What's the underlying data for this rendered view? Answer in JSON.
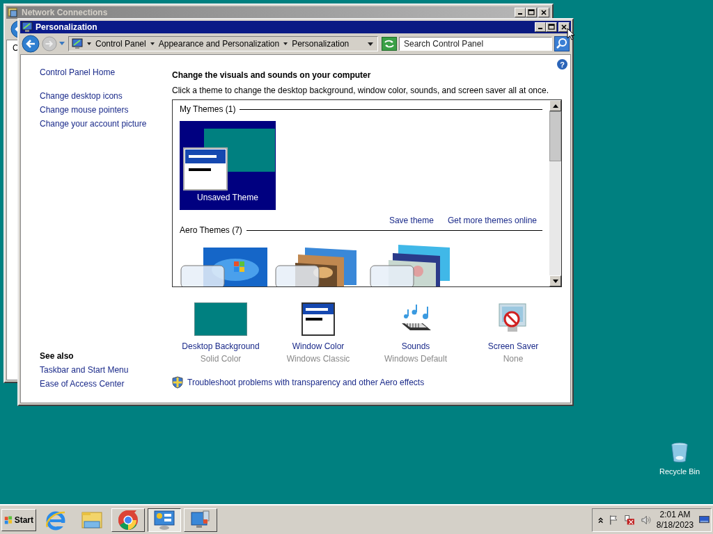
{
  "back_window": {
    "title": "Network Connections",
    "cut_text": "C"
  },
  "window": {
    "title": "Personalization",
    "breadcrumb": [
      "Control Panel",
      "Appearance and Personalization",
      "Personalization"
    ],
    "search": {
      "placeholder": "Search Control Panel"
    },
    "help": "?"
  },
  "sidebar": {
    "links": [
      "Control Panel Home",
      "Change desktop icons",
      "Change mouse pointers",
      "Change your account picture"
    ],
    "see_also_title": "See also",
    "see_also": [
      "Taskbar and Start Menu",
      "Ease of Access Center"
    ]
  },
  "heading": "Change the visuals and sounds on your computer",
  "subheading": "Click a theme to change the desktop background, window color, sounds, and screen saver all at once.",
  "my_themes": {
    "title": "My Themes (1)",
    "themes": [
      {
        "name": "Unsaved Theme",
        "selected": true
      }
    ]
  },
  "theme_links": [
    "Save theme",
    "Get more themes online"
  ],
  "aero_themes": {
    "title": "Aero Themes (7)"
  },
  "settings": [
    {
      "kind": "background",
      "label": "Desktop Background",
      "value": "Solid Color"
    },
    {
      "kind": "window_color",
      "label": "Window Color",
      "value": "Windows Classic"
    },
    {
      "kind": "sounds",
      "label": "Sounds",
      "value": "Windows Default"
    },
    {
      "kind": "screen_saver",
      "label": "Screen Saver",
      "value": "None"
    }
  ],
  "troubleshoot": "Troubleshoot problems with transparency and other Aero effects",
  "desktop_icons": [
    {
      "label": "Recycle Bin"
    }
  ],
  "taskbar": {
    "start": "Start",
    "buttons": [
      {
        "kind": "ie",
        "selected": false
      },
      {
        "kind": "folder",
        "selected": false
      },
      {
        "kind": "chrome",
        "selected": false
      },
      {
        "kind": "control_panel",
        "selected": true
      },
      {
        "kind": "network",
        "selected": false
      }
    ],
    "time": "2:01 AM",
    "date": "8/18/2023"
  }
}
